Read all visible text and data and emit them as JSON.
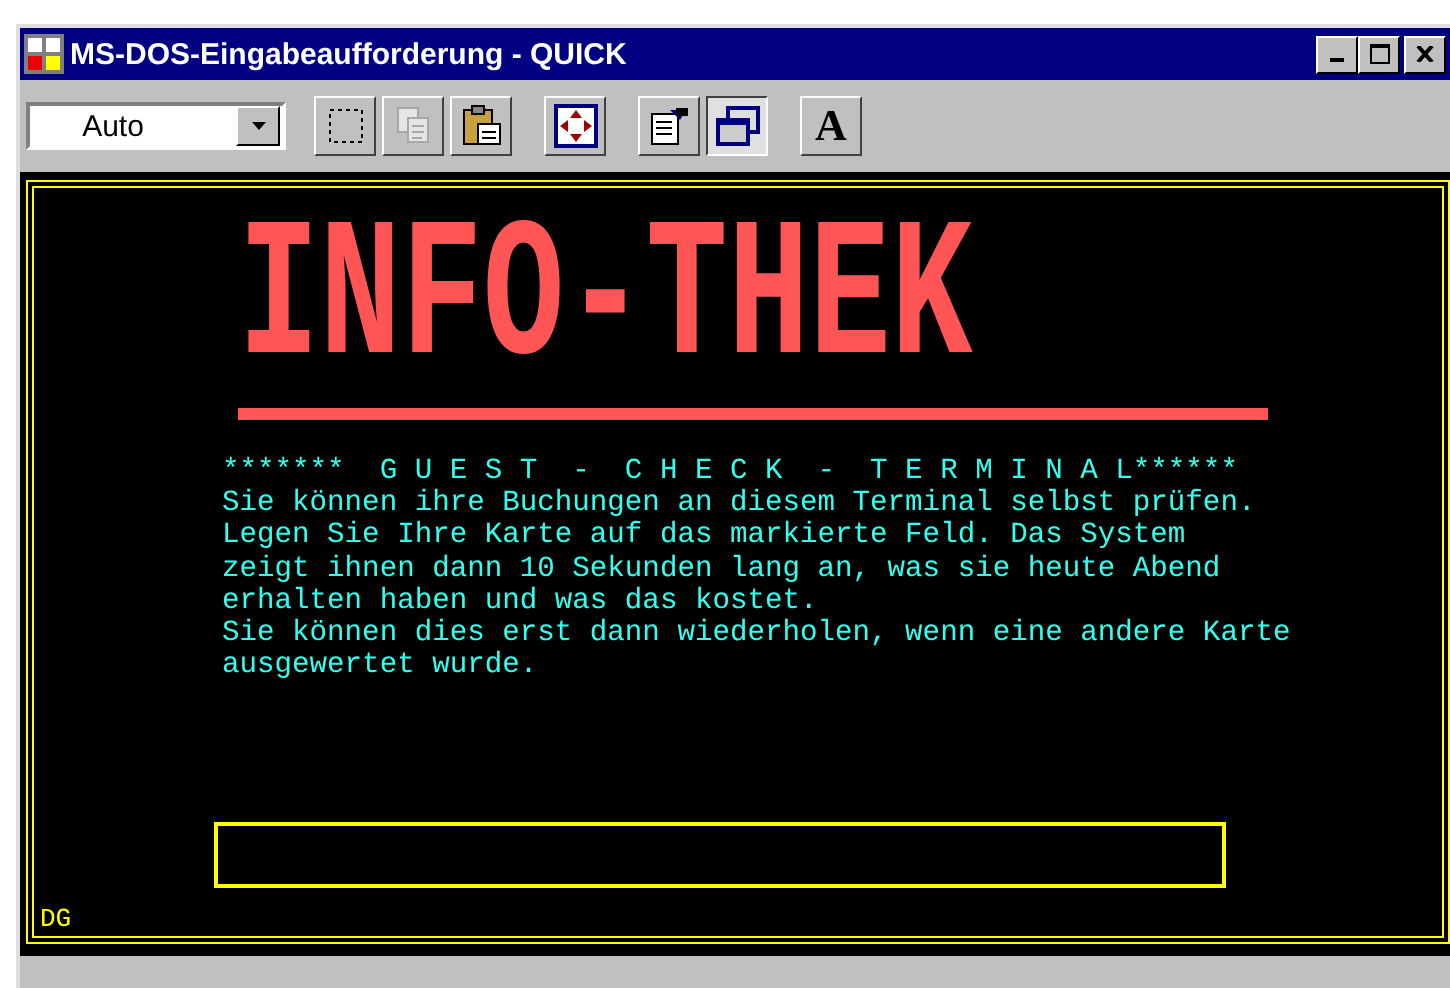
{
  "window": {
    "title": "MS-DOS-Eingabeaufforderung - QUICK"
  },
  "toolbar": {
    "font_size": "Auto",
    "buttons": [
      {
        "kind": "mark",
        "pressed": false,
        "disabled": false
      },
      {
        "kind": "copy",
        "pressed": false,
        "disabled": true
      },
      {
        "kind": "paste",
        "pressed": false,
        "disabled": false
      },
      {
        "kind": "fullscreen",
        "pressed": false,
        "disabled": false
      },
      {
        "kind": "properties",
        "pressed": false,
        "disabled": false
      },
      {
        "kind": "background",
        "pressed": true,
        "disabled": false
      },
      {
        "kind": "font",
        "pressed": false,
        "disabled": false,
        "label": "A"
      }
    ]
  },
  "console": {
    "logo": "INFO-THEK",
    "heading": "*******  G U E S T  -  C H E C K  -  T E R M I N A L******",
    "lines": [
      "Sie können ihre Buchungen an diesem Terminal selbst prüfen.",
      "Legen Sie Ihre Karte auf das markierte Feld. Das System",
      "zeigt ihnen dann 10 Sekunden lang an, was sie heute Abend",
      "erhalten haben und was das kostet.",
      "Sie können dies erst dann wiederholen, wenn eine andere Karte",
      "ausgewertet wurde."
    ],
    "footer": "DG"
  }
}
